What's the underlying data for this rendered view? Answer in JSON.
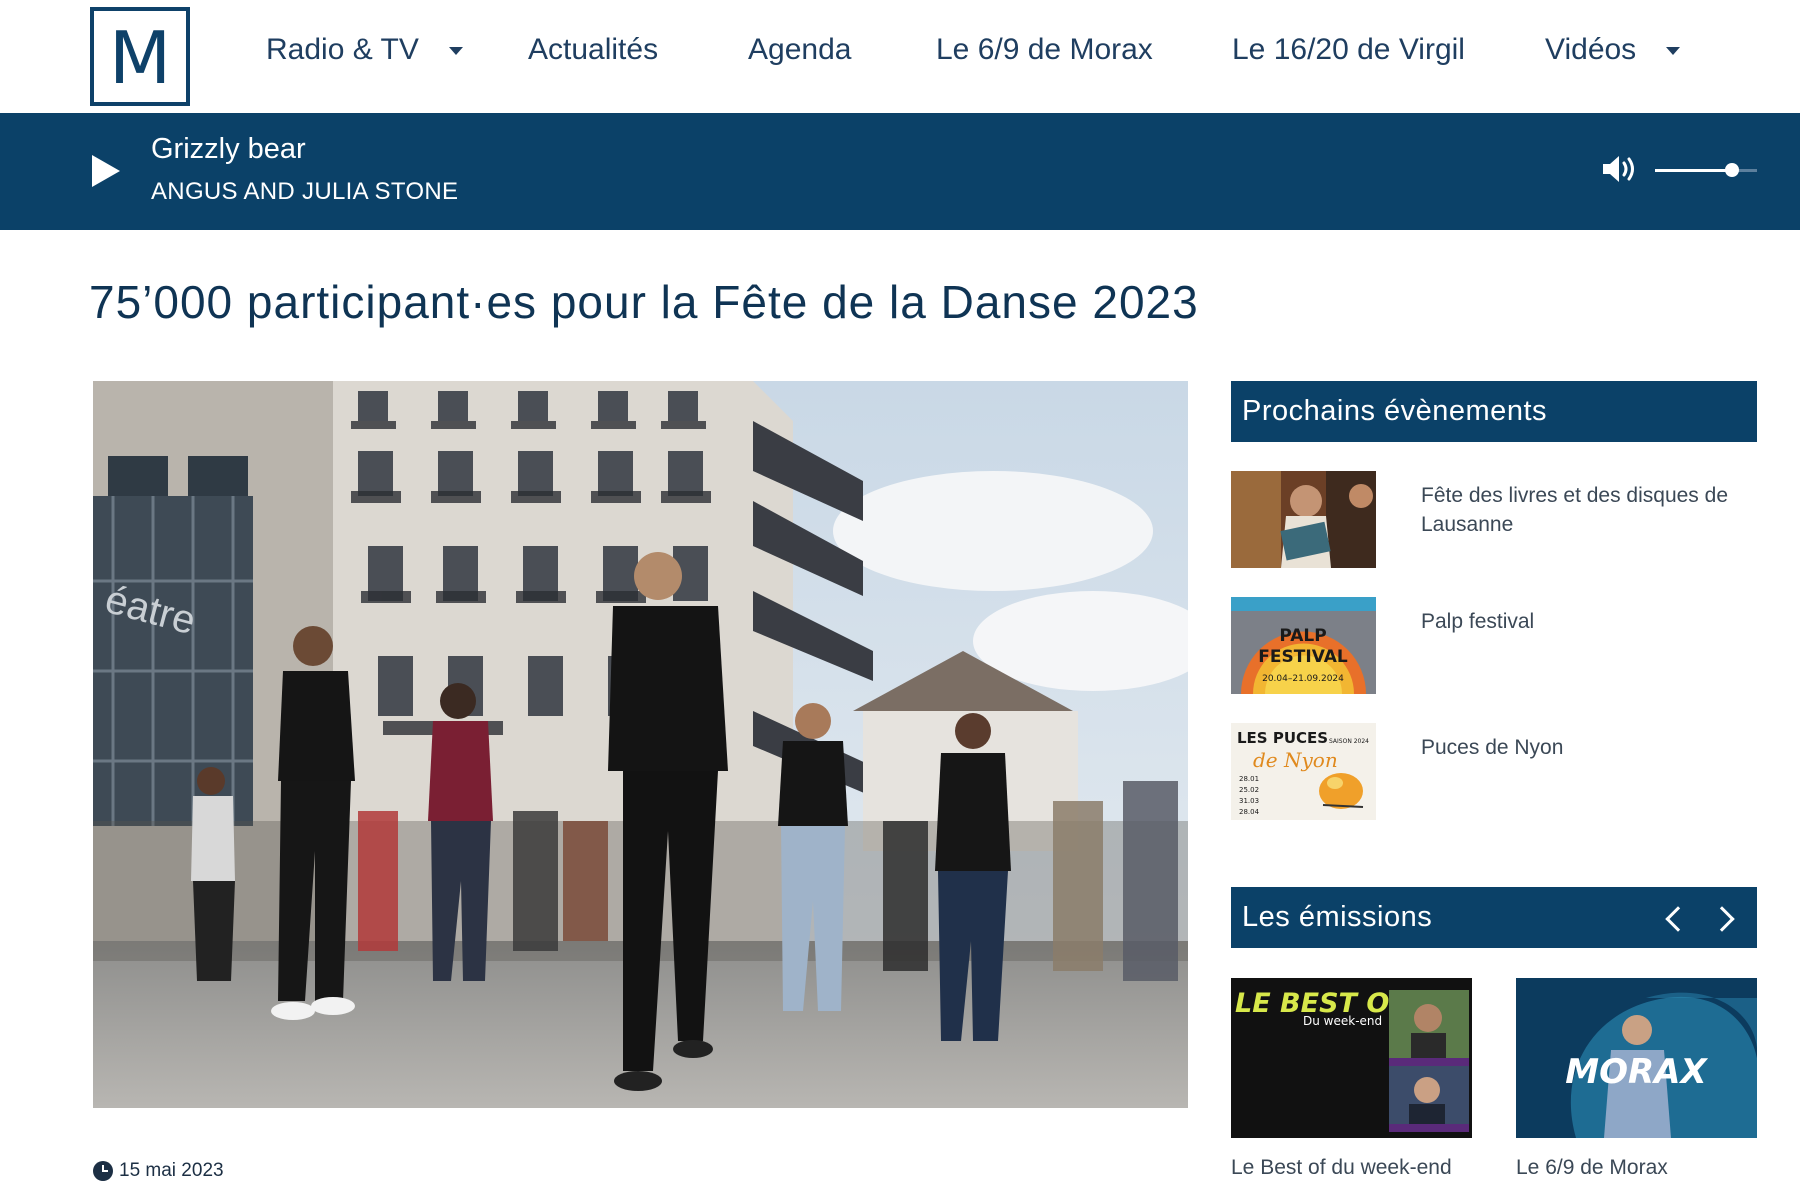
{
  "logo": {
    "letter": "M"
  },
  "nav": {
    "items": [
      {
        "label": "Radio & TV",
        "has_dropdown": true
      },
      {
        "label": "Actualités",
        "has_dropdown": false
      },
      {
        "label": "Agenda",
        "has_dropdown": false
      },
      {
        "label": "Le 6/9 de Morax",
        "has_dropdown": false
      },
      {
        "label": "Le 16/20 de Virgil",
        "has_dropdown": false
      },
      {
        "label": "Vidéos",
        "has_dropdown": true
      }
    ]
  },
  "player": {
    "title": "Grizzly bear",
    "artist": "Angus and Julia Stone",
    "volume": 0.75,
    "icons": {
      "play": "play-icon",
      "volume": "volume-icon"
    }
  },
  "article": {
    "headline": "75’000 participant·es pour la Fête de la Danse 2023",
    "date": "15 mai 2023"
  },
  "sidebar": {
    "events_heading": "Prochains évènements",
    "events": [
      {
        "label": "Fête des livres et des disques de Lausanne"
      },
      {
        "label": "Palp festival",
        "thumb_line1": "PALP",
        "thumb_line2": "FESTIVAL",
        "thumb_dates": "20.04–21.09.2024"
      },
      {
        "label": "Puces de Nyon",
        "thumb_line1": "LES PUCES",
        "thumb_line2": "de Nyon",
        "thumb_season": "SAISON 2024",
        "thumb_dates": [
          "28.01",
          "25.02",
          "31.03",
          "28.04"
        ]
      }
    ],
    "shows_heading": "Les émissions",
    "shows": [
      {
        "label": "Le Best of du week-end",
        "thumb_title": "LE BEST OF",
        "thumb_sub": "Du week-end"
      },
      {
        "label": "Le 6/9 de Morax",
        "thumb_title": "MORAX"
      }
    ]
  },
  "colors": {
    "brand_navy": "#0b4168",
    "text_dark": "#0f3454",
    "text_gray": "#3b4856"
  }
}
